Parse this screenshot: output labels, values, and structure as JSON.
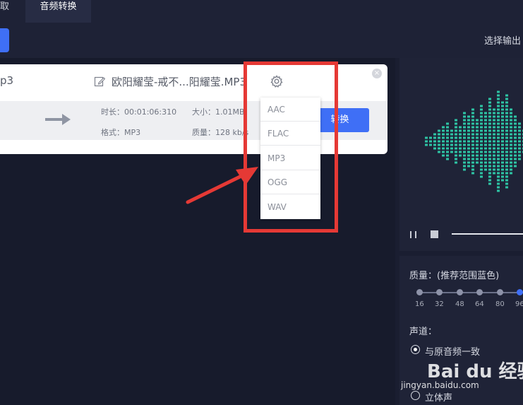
{
  "tabs": {
    "prev_label": "取",
    "active_label": "音频转换"
  },
  "toolbar": {
    "select_output_label": "选择输出"
  },
  "file": {
    "source_name": "p3",
    "output_name": "欧阳耀莹-戒不...阳耀莹.MP3",
    "duration": "时长：00:01:06:310",
    "size": "大小：1.01MB",
    "format": "格式：MP3",
    "quality": "质量：128 kb/s",
    "convert_label": "转换",
    "close_glyph": "×"
  },
  "format_menu": {
    "options": [
      "AAC",
      "FLAC",
      "MP3",
      "OGG",
      "WAV"
    ]
  },
  "settings": {
    "quality_title": "质量：(推荐范围蓝色)",
    "quality_ticks": [
      "16",
      "32",
      "48",
      "64",
      "80",
      "96"
    ],
    "channel_title": "声道：",
    "channel_options": [
      "与原音频一致",
      "立体声"
    ]
  },
  "watermark": {
    "brand": "Bai du 经验",
    "url": "jingyan.baidu.com"
  },
  "colors": {
    "accent": "#3f6ff6",
    "wave": "#2ec4a4",
    "highlight": "#e53935"
  },
  "icons": [
    "edit-icon",
    "gear-icon",
    "arrow-right-icon",
    "pause-icon",
    "stop-icon",
    "close-icon"
  ]
}
